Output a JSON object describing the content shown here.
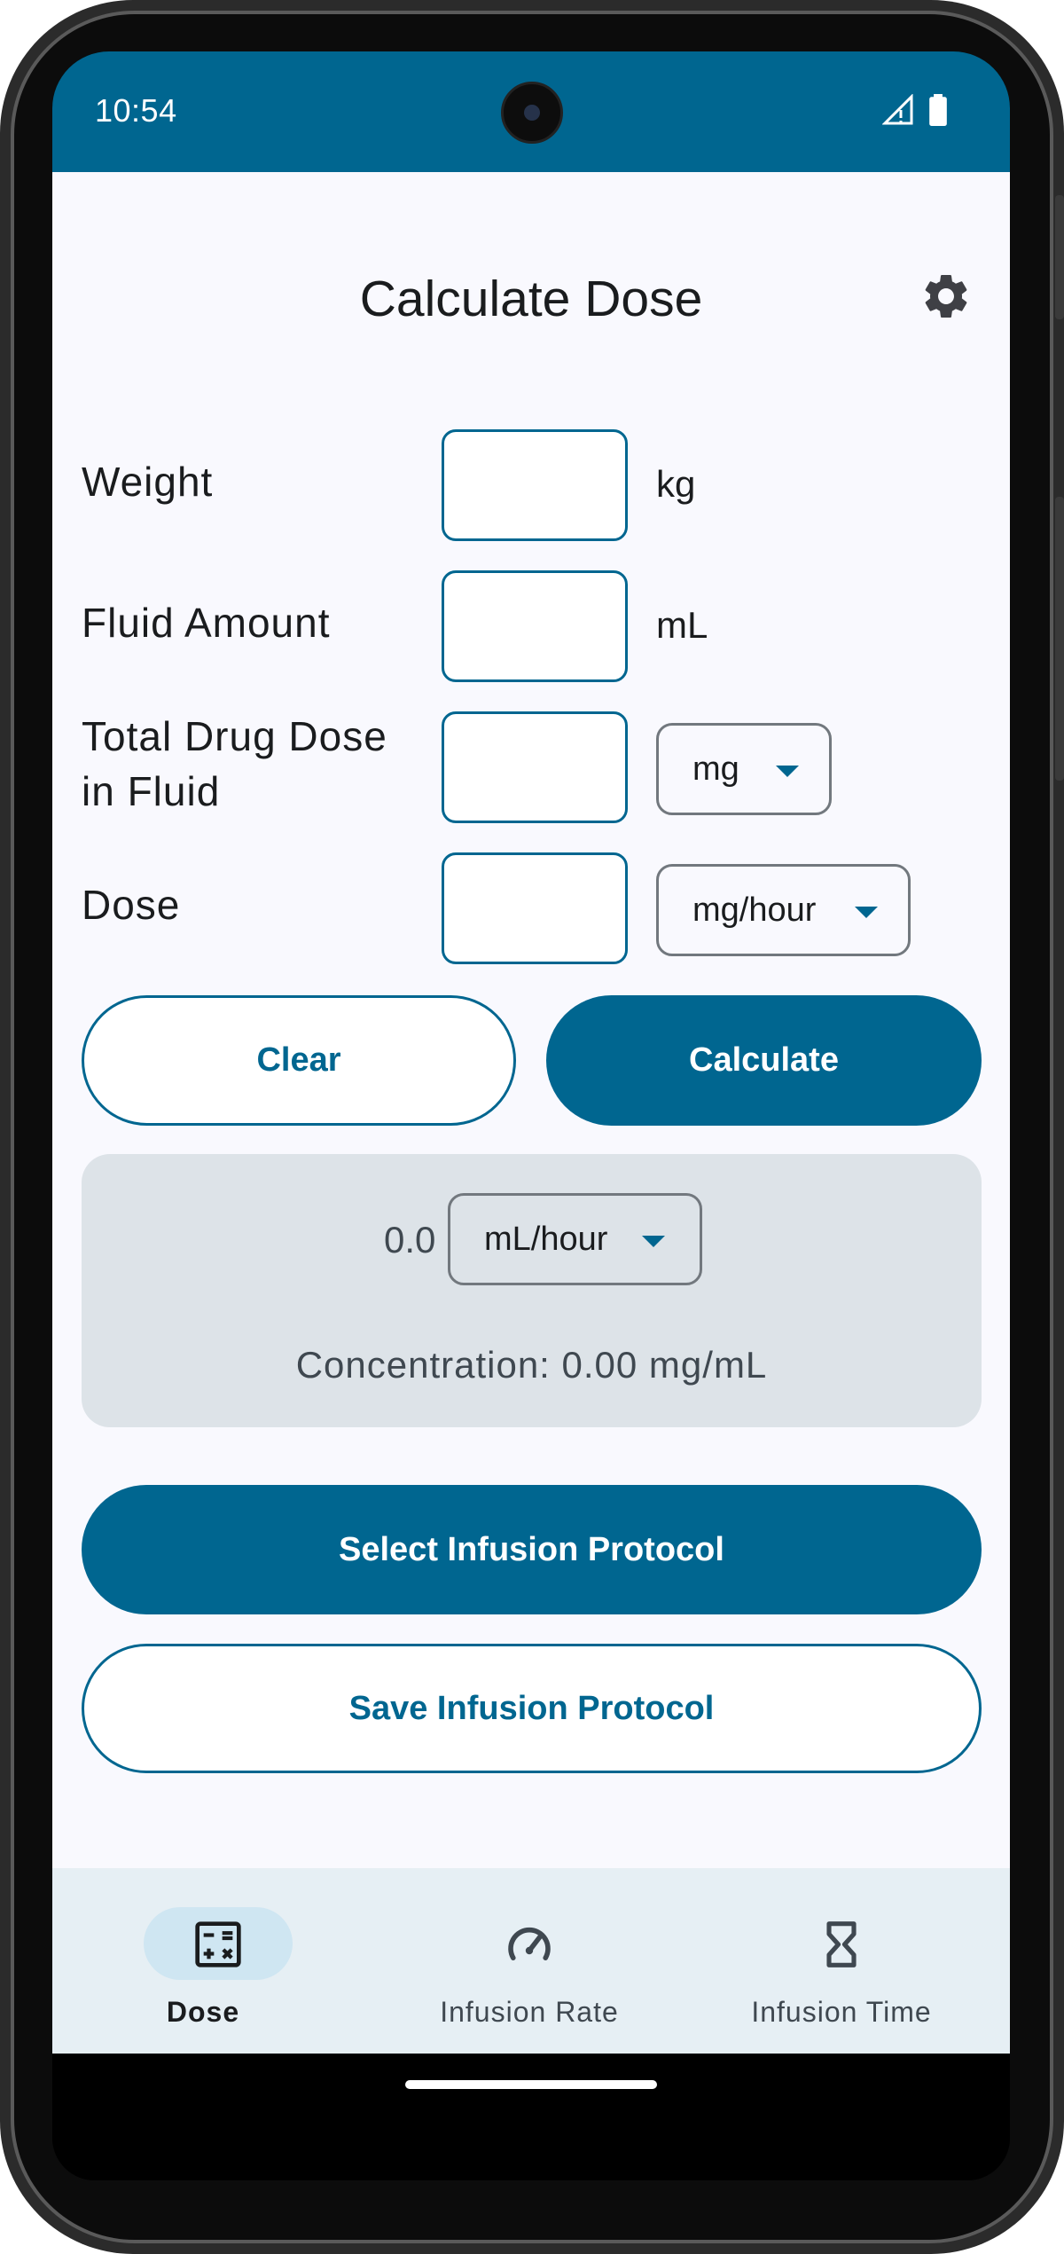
{
  "status_bar": {
    "time": "10:54"
  },
  "header": {
    "title": "Calculate Dose",
    "settings_icon": "gear-icon"
  },
  "form": {
    "weight": {
      "label": "Weight",
      "value": "",
      "unit": "kg"
    },
    "fluid_amount": {
      "label": "Fluid Amount",
      "value": "",
      "unit": "mL"
    },
    "total_drug_dose": {
      "label_line1": "Total Drug Dose",
      "label_line2": "in Fluid",
      "value": "",
      "unit_selected": "mg"
    },
    "dose": {
      "label": "Dose",
      "value": "",
      "unit_selected": "mg/hour"
    }
  },
  "buttons": {
    "clear": "Clear",
    "calculate": "Calculate",
    "select_protocol": "Select Infusion Protocol",
    "save_protocol": "Save Infusion Protocol"
  },
  "result": {
    "value": "0.0",
    "unit_selected": "mL/hour",
    "concentration": "Concentration: 0.00 mg/mL"
  },
  "bottom_nav": {
    "items": [
      {
        "label": "Dose",
        "icon": "calculator-icon",
        "selected": true
      },
      {
        "label": "Infusion Rate",
        "icon": "speedometer-icon",
        "selected": false
      },
      {
        "label": "Infusion Time",
        "icon": "hourglass-icon",
        "selected": false
      }
    ]
  },
  "colors": {
    "primary": "#006690",
    "surface": "#f9f9fe",
    "card": "#dde3e8",
    "nav_background": "#e6eff4",
    "nav_selected_pill": "#cfe6f2"
  }
}
